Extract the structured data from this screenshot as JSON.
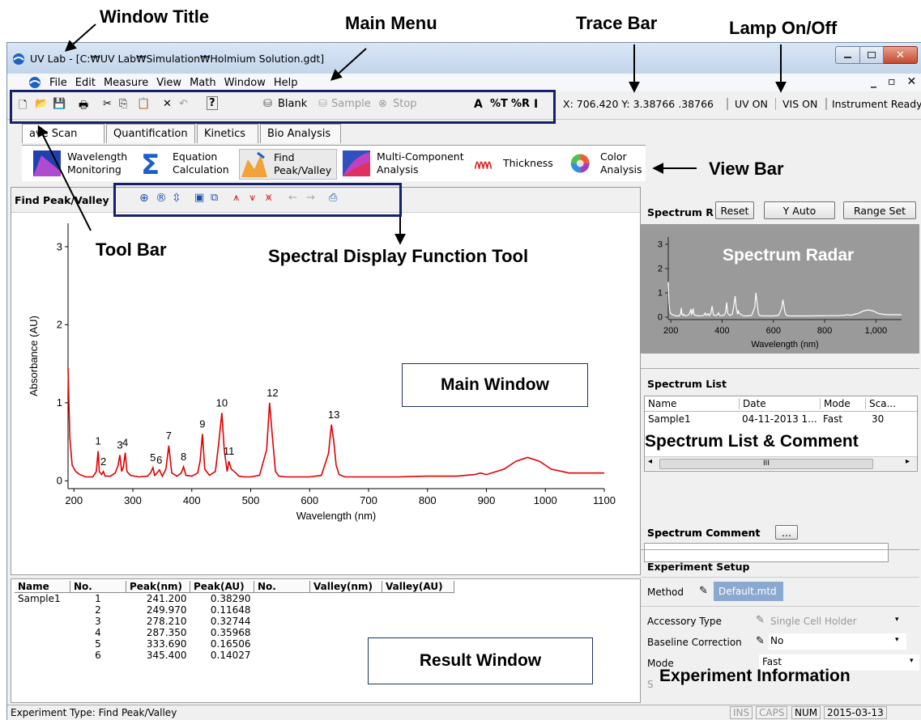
{
  "window": {
    "title": "UV Lab - [C:₩UV Lab₩Simulation₩Holmium Solution.gdt]"
  },
  "menu": [
    "File",
    "Edit",
    "Measure",
    "View",
    "Math",
    "Window",
    "Help"
  ],
  "toolbar": {
    "blank_label": "Blank",
    "sample_label": "Sample",
    "stop_label": "Stop",
    "unit_a": "A",
    "unit_t": "%T",
    "unit_r": "%R",
    "unit_i": "I"
  },
  "trace_bar": {
    "readout": "X: 706.420 Y: 3.38766 .38766",
    "uv_label": "UV ON",
    "vis_label": "VIS ON",
    "status": "Instrument Ready"
  },
  "tabs": [
    "ave Scan",
    "Quantification",
    "Kinetics",
    "Bio Analysis"
  ],
  "view_bar": [
    {
      "line1": "Wavelength",
      "line2": "Monitoring",
      "icon": "wavelength-monitoring-icon"
    },
    {
      "line1": "Equation",
      "line2": "Calculation",
      "icon": "sigma-icon"
    },
    {
      "line1": "Find",
      "line2": "Peak/Valley",
      "icon": "find-peak-icon"
    },
    {
      "line1": "Multi-Component",
      "line2": "Analysis",
      "icon": "multi-component-icon"
    },
    {
      "line1": "Thickness",
      "line2": "",
      "icon": "thickness-icon"
    },
    {
      "line1": "Color",
      "line2": "Analysis",
      "icon": "color-wheel-icon"
    }
  ],
  "spectral_panel": {
    "title": "Find Peak/Valley"
  },
  "callouts": {
    "window_title": "Window Title",
    "main_menu": "Main Menu",
    "trace_bar": "Trace Bar",
    "lamp": "Lamp On/Off",
    "view_bar": "View Bar",
    "tool_bar": "Tool Bar",
    "spectral_tool": "Spectral Display Function Tool",
    "main_window": "Main Window",
    "result_window": "Result Window",
    "spectrum_list_comment": "Spectrum List & Comment",
    "experiment_information": "Experiment Information",
    "spectrum_radar": "Spectrum Radar"
  },
  "chart_data": [
    {
      "type": "line",
      "title": "",
      "xlabel": "Wavelength (nm)",
      "ylabel": "Absorbance (AU)",
      "xlim": [
        190,
        1100
      ],
      "ylim": [
        -0.1,
        3.3
      ],
      "xticks": [
        200,
        300,
        400,
        500,
        600,
        700,
        800,
        900,
        1000,
        1100
      ],
      "yticks": [
        0,
        1,
        2,
        3
      ],
      "color": "#e00000",
      "x": [
        190,
        193,
        197,
        203,
        210,
        220,
        232,
        238,
        241,
        243,
        247,
        250,
        253,
        262,
        270,
        275,
        278,
        281,
        284,
        287,
        290,
        296,
        310,
        325,
        330,
        334,
        337,
        341,
        345,
        350,
        356,
        361,
        366,
        375,
        382,
        386,
        390,
        400,
        410,
        414,
        418,
        422,
        430,
        440,
        446,
        451,
        455,
        460,
        463,
        467,
        472,
        480,
        490,
        500,
        515,
        527,
        532,
        537,
        542,
        548,
        560,
        580,
        600,
        620,
        632,
        637,
        641,
        645,
        650,
        660,
        700,
        750,
        800,
        850,
        880,
        890,
        900,
        930,
        950,
        970,
        990,
        1010,
        1040,
        1070,
        1100
      ],
      "y": [
        1.45,
        0.55,
        0.2,
        0.12,
        0.08,
        0.05,
        0.05,
        0.12,
        0.38,
        0.12,
        0.08,
        0.12,
        0.06,
        0.06,
        0.1,
        0.2,
        0.33,
        0.12,
        0.18,
        0.36,
        0.12,
        0.07,
        0.05,
        0.06,
        0.1,
        0.17,
        0.07,
        0.1,
        0.14,
        0.06,
        0.15,
        0.45,
        0.1,
        0.06,
        0.1,
        0.18,
        0.07,
        0.06,
        0.1,
        0.25,
        0.6,
        0.15,
        0.07,
        0.12,
        0.5,
        0.87,
        0.4,
        0.12,
        0.25,
        0.15,
        0.12,
        0.06,
        0.05,
        0.05,
        0.07,
        0.4,
        1.0,
        0.55,
        0.12,
        0.06,
        0.05,
        0.05,
        0.05,
        0.07,
        0.35,
        0.72,
        0.5,
        0.2,
        0.08,
        0.05,
        0.05,
        0.05,
        0.06,
        0.06,
        0.08,
        0.1,
        0.08,
        0.15,
        0.25,
        0.3,
        0.25,
        0.15,
        0.1,
        0.1,
        0.1
      ],
      "peak_labels": [
        {
          "label": "1",
          "x": 241,
          "y": 0.38
        },
        {
          "label": "2",
          "x": 250,
          "y": 0.12
        },
        {
          "label": "3",
          "x": 278,
          "y": 0.33
        },
        {
          "label": "4",
          "x": 287,
          "y": 0.36
        },
        {
          "label": "5",
          "x": 334,
          "y": 0.17
        },
        {
          "label": "6",
          "x": 345,
          "y": 0.14
        },
        {
          "label": "7",
          "x": 361,
          "y": 0.45
        },
        {
          "label": "8",
          "x": 386,
          "y": 0.18
        },
        {
          "label": "9",
          "x": 418,
          "y": 0.6
        },
        {
          "label": "10",
          "x": 451,
          "y": 0.87
        },
        {
          "label": "11",
          "x": 463,
          "y": 0.25
        },
        {
          "label": "12",
          "x": 537,
          "y": 1.0
        },
        {
          "label": "13",
          "x": 641,
          "y": 0.72
        }
      ]
    },
    {
      "type": "line",
      "title": "",
      "xlabel": "Wavelength (nm)",
      "ylabel": "",
      "xlim": [
        190,
        1100
      ],
      "ylim": [
        -0.1,
        3.3
      ],
      "xticks": [
        200,
        400,
        600,
        800,
        1000
      ],
      "xtick_labels": [
        "200",
        "400",
        "600",
        "800",
        "1,000"
      ],
      "yticks": [
        0,
        1,
        2,
        3
      ],
      "color": "#ffffff"
    }
  ],
  "results": {
    "headers": [
      "Name",
      "No.",
      "Peak(nm)",
      "Peak(AU)",
      "No.",
      "Valley(nm)",
      "Valley(AU)"
    ],
    "rows": [
      [
        "Sample1",
        "1",
        "241.200",
        "0.38290"
      ],
      [
        "",
        "2",
        "249.970",
        "0.11648"
      ],
      [
        "",
        "3",
        "278.210",
        "0.32744"
      ],
      [
        "",
        "4",
        "287.350",
        "0.35968"
      ],
      [
        "",
        "5",
        "333.690",
        "0.16506"
      ],
      [
        "",
        "6",
        "345.400",
        "0.14027"
      ]
    ]
  },
  "radar": {
    "title": "Spectrum R",
    "reset_label": "Reset",
    "yauto_label": "Y Auto",
    "rangeset_label": "Range Set"
  },
  "spectrum_list": {
    "title": "Spectrum List",
    "headers": [
      "Name",
      "Date",
      "Mode",
      "Sca..."
    ],
    "row": [
      "Sample1",
      "04-11-2013 1...",
      "Fast",
      "30"
    ],
    "scroll_grip": "III",
    "comment_title": "Spectrum Comment",
    "comment_button": "..."
  },
  "experiment": {
    "title": "Experiment Setup",
    "method_label": "Method",
    "method_value": "Default.mtd",
    "accessory_label": "Accessory Type",
    "accessory_value": "Single Cell Holder",
    "baseline_label": "Baseline Correction",
    "baseline_value": "No",
    "mode_label": "Mode",
    "mode_value": "Fast",
    "partial_label": "S"
  },
  "statusbar": {
    "text": "Experiment Type: Find Peak/Valley",
    "ins": "INS",
    "caps": "CAPS",
    "num": "NUM",
    "date": "2015-03-13"
  }
}
